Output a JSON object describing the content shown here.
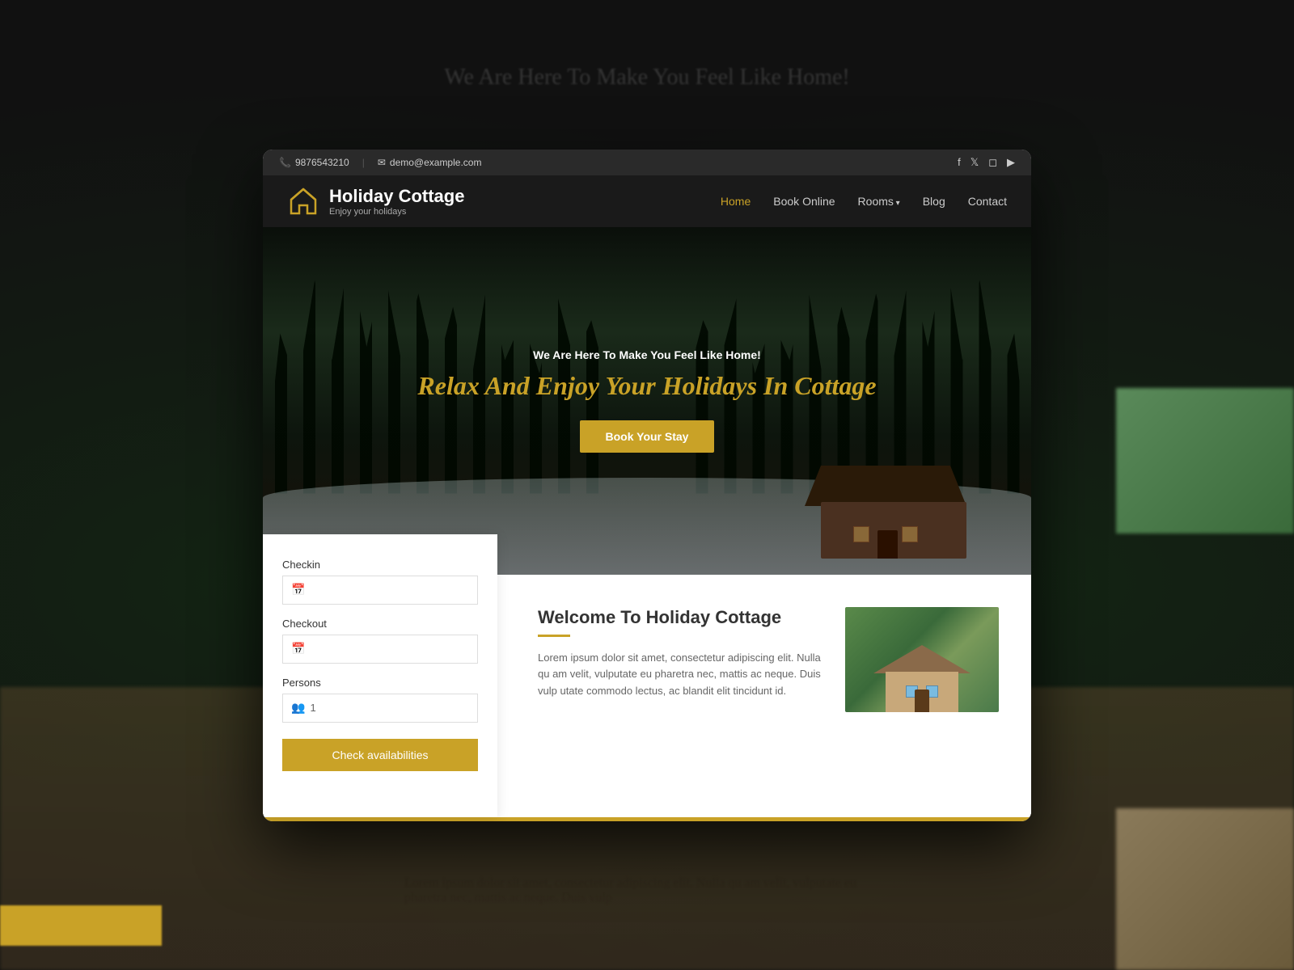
{
  "page": {
    "bg_text": "We Are Here To Make You Feel Like Home!",
    "bg_lorem": "Lorem ipsum dolor sit amet, consectetur adipiscing elit. Nulla qu am velit, vulputate eu pharetra nec, mattis ac neque. Duis vulp"
  },
  "topbar": {
    "phone": "9876543210",
    "email": "demo@example.com",
    "phone_icon": "📞",
    "email_icon": "✉"
  },
  "navbar": {
    "logo_name": "Holiday Cottage",
    "logo_tagline": "Enjoy your holidays",
    "nav_items": [
      {
        "label": "Home",
        "active": true
      },
      {
        "label": "Book Online",
        "active": false
      },
      {
        "label": "Rooms",
        "active": false,
        "dropdown": true
      },
      {
        "label": "Blog",
        "active": false
      },
      {
        "label": "Contact",
        "active": false
      }
    ]
  },
  "hero": {
    "subtitle": "We Are Here To Make You Feel Like Home!",
    "title": "Relax And Enjoy Your Holidays In Cottage",
    "cta_label": "Book Your Stay"
  },
  "booking": {
    "checkin_label": "Checkin",
    "checkout_label": "Checkout",
    "persons_label": "Persons",
    "persons_value": "1",
    "button_label": "Check availabilities"
  },
  "welcome": {
    "title": "Welcome To Holiday Cottage",
    "description": "Lorem ipsum dolor sit amet, consectetur adipiscing elit. Nulla qu am velit, vulputate eu pharetra nec, mattis ac neque. Duis vulp utate commodo lectus, ac blandit elit tincidunt id."
  }
}
